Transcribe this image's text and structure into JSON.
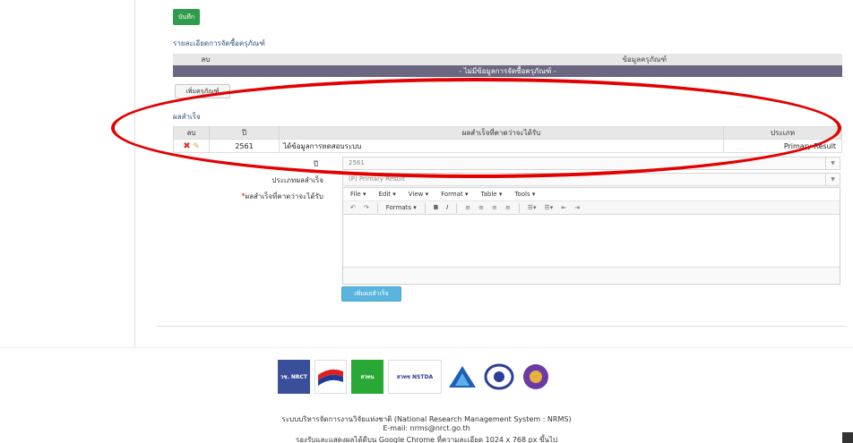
{
  "actions": {
    "save_label": "บันทึก",
    "add_equipment_label": "เพิ่มครุภัณฑ์",
    "add_result_label": "เพิ่มผลสำเร็จ"
  },
  "equipment": {
    "section_title": "รายละเอียดการจัดซื้อครุภัณฑ์",
    "col_delete": "ลบ",
    "col_info": "ข้อมูลครุภัณฑ์",
    "empty_message": "- ไม่มีข้อมูลการจัดซื้อครุภัณฑ์ -"
  },
  "results": {
    "section_title": "ผลสำเร็จ",
    "columns": [
      "ลบ",
      "ปี",
      "ผลสำเร็จที่คาดว่าจะได้รับ",
      "ประเภท"
    ],
    "rows": [
      {
        "year": "2561",
        "result": "ได้ข้อมูลการทดสอบระบบ",
        "type": "Primary Result"
      }
    ]
  },
  "form": {
    "year_label": "ปี",
    "year_value": "2561",
    "type_label": "ประเภทผลสำเร็จ",
    "type_value": "(P) Primary Result",
    "expected_label": "ผลสำเร็จที่คาดว่าจะได้รับ",
    "required_mark": "*"
  },
  "editor": {
    "menu": [
      "File ▾",
      "Edit ▾",
      "View ▾",
      "Format ▾",
      "Table ▾",
      "Tools ▾"
    ],
    "formats_label": "Formats ▾"
  },
  "footer": {
    "line1": "ระบบบริหารจัดการงานวิจัยแห่งชาติ (National Research Management System : NRMS)",
    "line2": "E-mail: nrms@nrct.go.th",
    "line3": "รองรับและแสดงผลได้ดีบน Google Chrome ที่ความละเอียด 1024 x 768 px ขึ้นไป",
    "logo_labels": [
      "วช. NRCT",
      "",
      "สวทน",
      "สวทช NSTDA",
      "",
      "สกว",
      ""
    ]
  }
}
